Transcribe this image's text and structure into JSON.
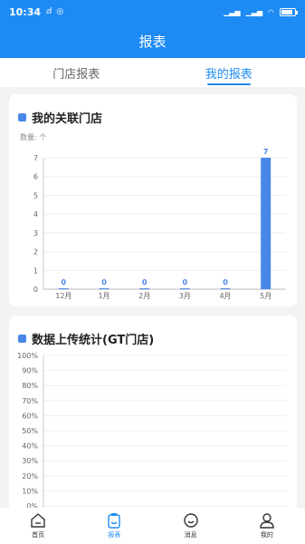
{
  "status": {
    "time": "10:34",
    "carrier_icons": [
      "sim-icon",
      "location-icon"
    ],
    "battery_level": 0.7
  },
  "title": "报表",
  "tabs": [
    {
      "label": "门店报表",
      "active": false
    },
    {
      "label": "我的报表",
      "active": true
    }
  ],
  "card1": {
    "title": "我的关联门店",
    "chart_data": {
      "type": "bar",
      "title": "",
      "ylabel": "数量: 个",
      "categories": [
        "12月",
        "1月",
        "2月",
        "3月",
        "4月",
        "5月"
      ],
      "values": [
        0,
        0,
        0,
        0,
        0,
        7
      ],
      "ylim": [
        0,
        7
      ],
      "yticks": [
        0,
        1,
        2,
        3,
        4,
        5,
        6,
        7
      ],
      "grid": true,
      "bar_color": "#4a86e8"
    }
  },
  "card2": {
    "title": "数据上传统计(GT门店)",
    "chart_data": {
      "type": "bar",
      "title": "",
      "ylim": [
        0,
        100
      ],
      "yticks": [
        "100%",
        "90%",
        "80%",
        "70%",
        "60%",
        "50%",
        "40%",
        "30%",
        "20%",
        "10%",
        "0%"
      ],
      "grid": true
    }
  },
  "nav": [
    {
      "label": "首页",
      "icon": "home-icon",
      "active": false
    },
    {
      "label": "报表",
      "icon": "report-icon",
      "active": true
    },
    {
      "label": "消息",
      "icon": "message-icon",
      "active": false
    },
    {
      "label": "我的",
      "icon": "profile-icon",
      "active": false
    }
  ],
  "colors": {
    "primary": "#1e8bf5",
    "bar": "#4a86e8"
  }
}
